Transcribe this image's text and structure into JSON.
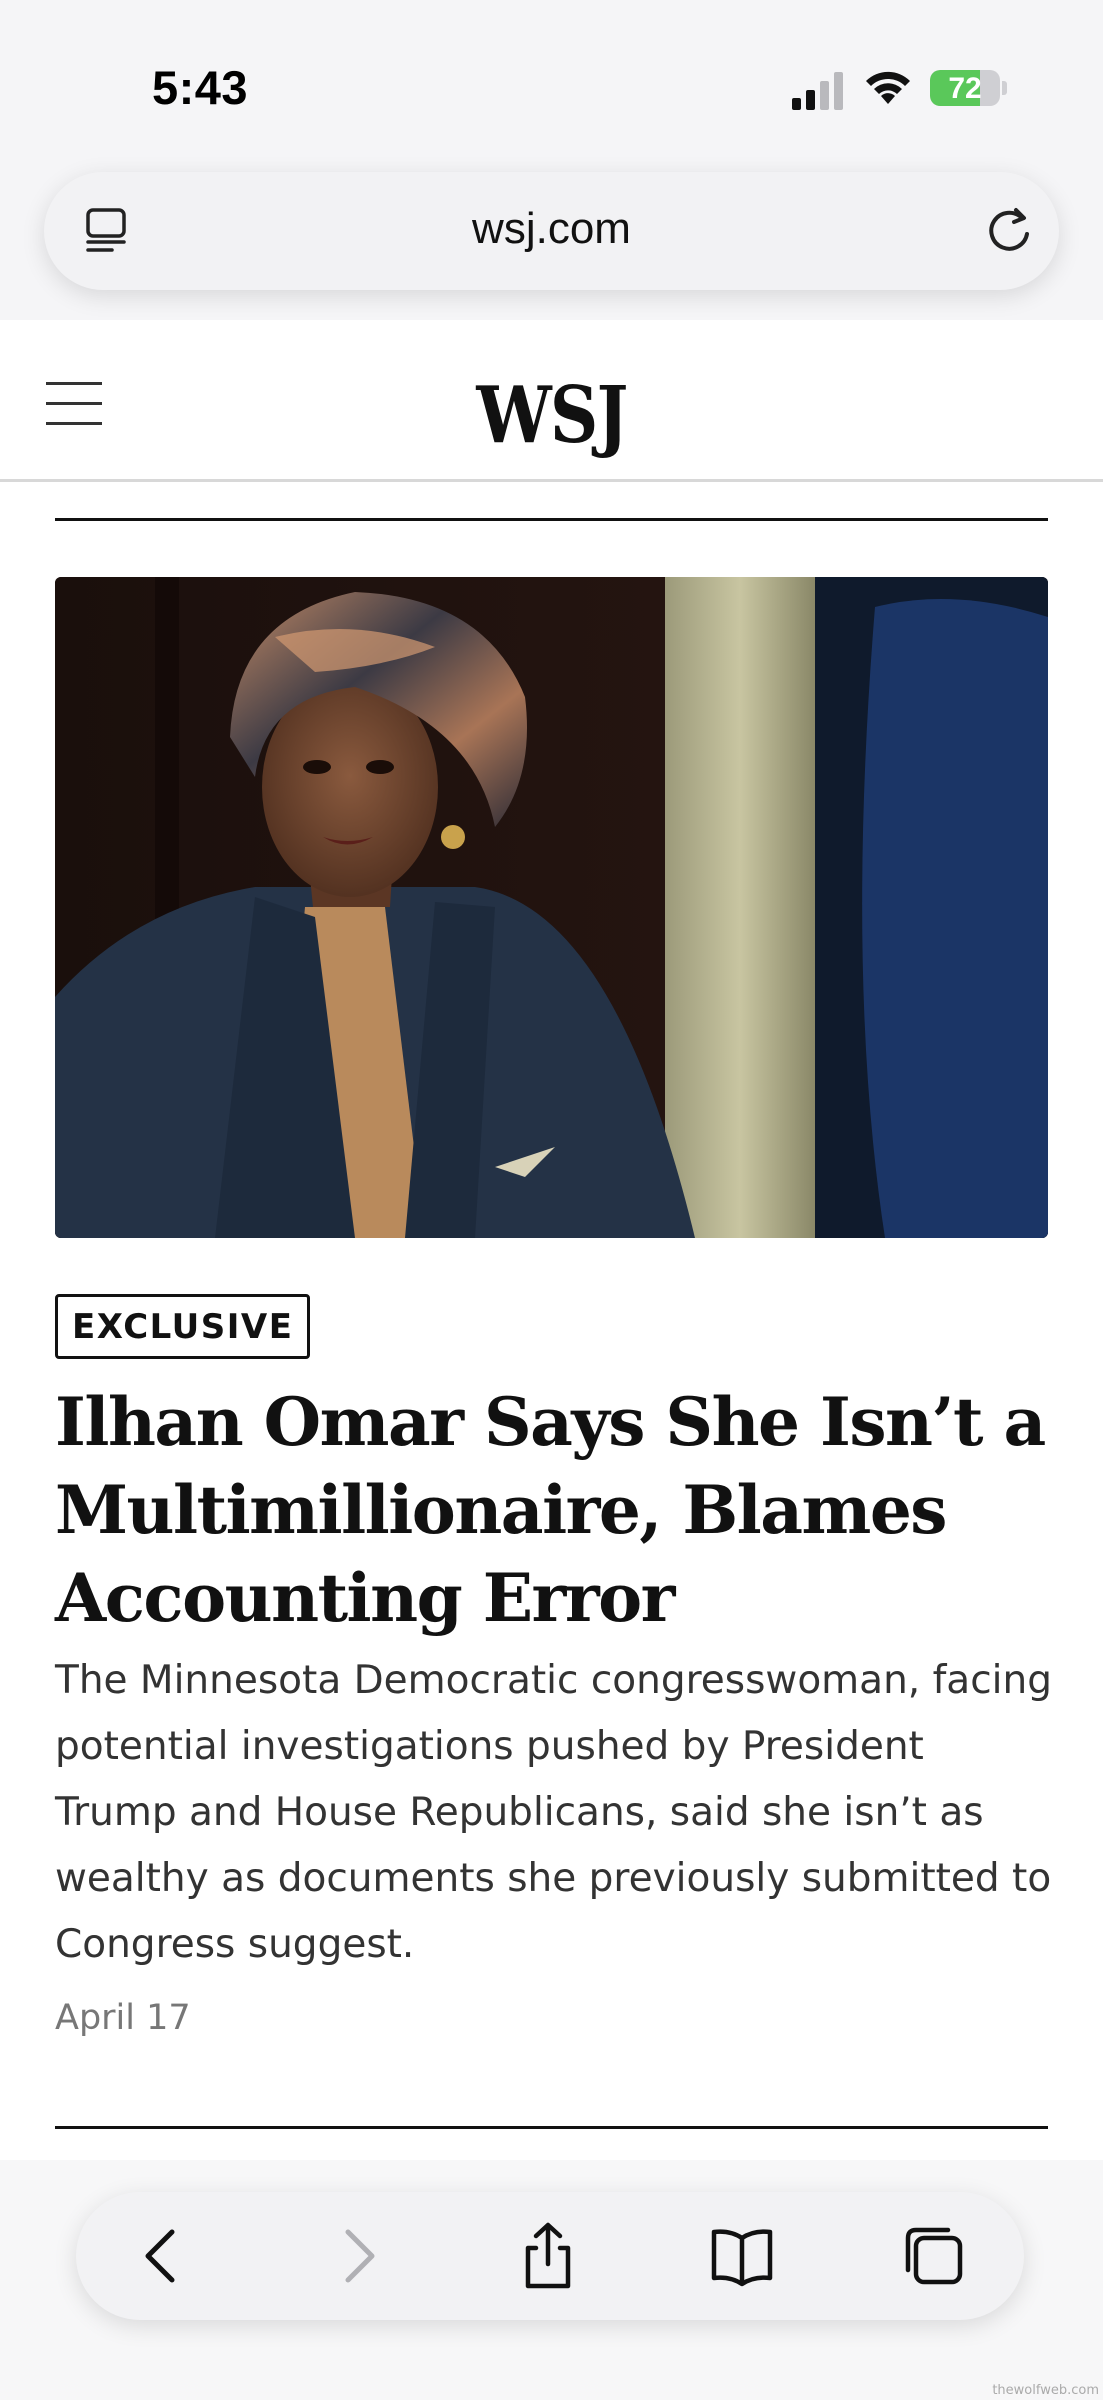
{
  "status_bar": {
    "time": "5:43",
    "battery_percent": "72",
    "battery_level": 0.72,
    "icons": [
      "cellular-signal-icon",
      "wifi-icon",
      "battery-charging-icon"
    ]
  },
  "browser": {
    "url": "wsj.com",
    "icons": [
      "reader-mode-icon",
      "reload-icon"
    ]
  },
  "site_header": {
    "logo": "WSJ",
    "icons": [
      "hamburger-menu-icon"
    ]
  },
  "article": {
    "badge": "EXCLUSIVE",
    "headline": "Ilhan Omar Says She Isn’t a Multimillionaire, Blames Accounting Error",
    "summary": "The Minnesota Democratic congresswoman, facing potential investigations pushed by President Trump and House Republicans, said she isn’t as wealthy as documents she previously submitted to Congress suggest.",
    "date": "April 17"
  },
  "toolbar": {
    "icons": [
      "back-icon",
      "forward-icon",
      "share-icon",
      "bookmarks-icon",
      "tabs-icon"
    ],
    "forward_enabled": false
  },
  "watermark": "thewolfweb.com",
  "colors": {
    "text": "#111111",
    "summary": "#333333",
    "date": "#777777",
    "battery_green": "#5ac85a",
    "chrome_bg": "#f5f5f7"
  }
}
